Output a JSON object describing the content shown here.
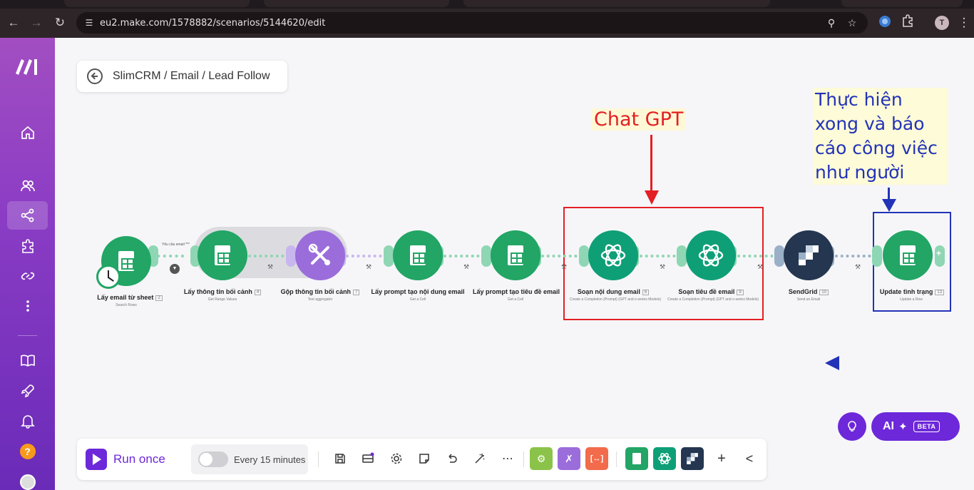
{
  "browser": {
    "url": "eu2.make.com/1578882/scenarios/5144620/edit",
    "profile_initial": "T"
  },
  "sidebar": {
    "items": [
      {
        "name": "home-icon"
      },
      {
        "name": "team-icon"
      },
      {
        "name": "scenarios-icon",
        "active": true
      },
      {
        "name": "templates-icon"
      },
      {
        "name": "connections-icon"
      },
      {
        "name": "more-icon"
      },
      {
        "name": "docs-icon"
      },
      {
        "name": "launch-icon"
      },
      {
        "name": "notifications-icon"
      },
      {
        "name": "help-icon"
      },
      {
        "name": "profile-icon"
      }
    ],
    "help_label": "?"
  },
  "breadcrumb": {
    "text": "SlimCRM / Email / Lead Follow"
  },
  "annotations": {
    "chat_gpt": "Chat GPT",
    "note": "Thực hiện xong và báo cáo công việc như người"
  },
  "modules": [
    {
      "label": "Lấy email từ sheet",
      "num": "2",
      "sub": "Search Rows",
      "type": "google-sheets"
    },
    {
      "label": "Lấy thông tin bối cảnh",
      "num": "4",
      "sub": "Get Range Values",
      "type": "google-sheets"
    },
    {
      "label": "Gộp thông tin bối cảnh",
      "num": "7",
      "sub": "Text aggregator",
      "type": "tools"
    },
    {
      "label": "Lấy prompt tạo nội dung email",
      "num": "",
      "sub": "Get a Cell",
      "type": "google-sheets"
    },
    {
      "label": "Lấy prompt tạo tiêu đề email",
      "num": "",
      "sub": "Get a Cell",
      "type": "google-sheets"
    },
    {
      "label": "Soạn nội dung email",
      "num": "6",
      "sub": "Create a Completion (Prompt) (GPT and o-series Models)",
      "type": "openai"
    },
    {
      "label": "Soạn tiêu đề email",
      "num": "9",
      "sub": "Create a Completion (Prompt) (GPT and o-series Models)",
      "type": "openai"
    },
    {
      "label": "SendGrid",
      "num": "10",
      "sub": "Send an Email",
      "type": "sendgrid"
    },
    {
      "label": "Update tình trạng",
      "num": "13",
      "sub": "Update a Row",
      "type": "google-sheets"
    }
  ],
  "flow": {
    "filter_label": "Yêu cầu email ***"
  },
  "bottombar": {
    "run_label": "Run once",
    "schedule_label": "Every 15 minutes",
    "tools": [
      "save-icon",
      "publish-icon",
      "settings-icon",
      "notes-icon",
      "undo-icon",
      "auto-align-icon",
      "more-icon"
    ],
    "apps": [
      {
        "name": "tools-app-chip",
        "color": "#8bc34a"
      },
      {
        "name": "flow-control-app-chip",
        "color": "#9b6ddb"
      },
      {
        "name": "text-parser-app-chip",
        "color": "#f26b4b"
      },
      {
        "name": "google-sheets-app-chip",
        "color": "#22a565"
      },
      {
        "name": "openai-app-chip",
        "color": "#0f9f77"
      },
      {
        "name": "sendgrid-app-chip",
        "color": "#243650"
      }
    ],
    "add_label": "+",
    "collapse_label": "<"
  },
  "ai": {
    "label": "AI",
    "badge": "BETA"
  },
  "colors": {
    "accent": "#6d28d9",
    "sheets": "#22a565",
    "openai": "#0f9f77",
    "tools": "#9b6ddb",
    "annotation_red": "#e32024",
    "annotation_blue": "#2333b8"
  }
}
